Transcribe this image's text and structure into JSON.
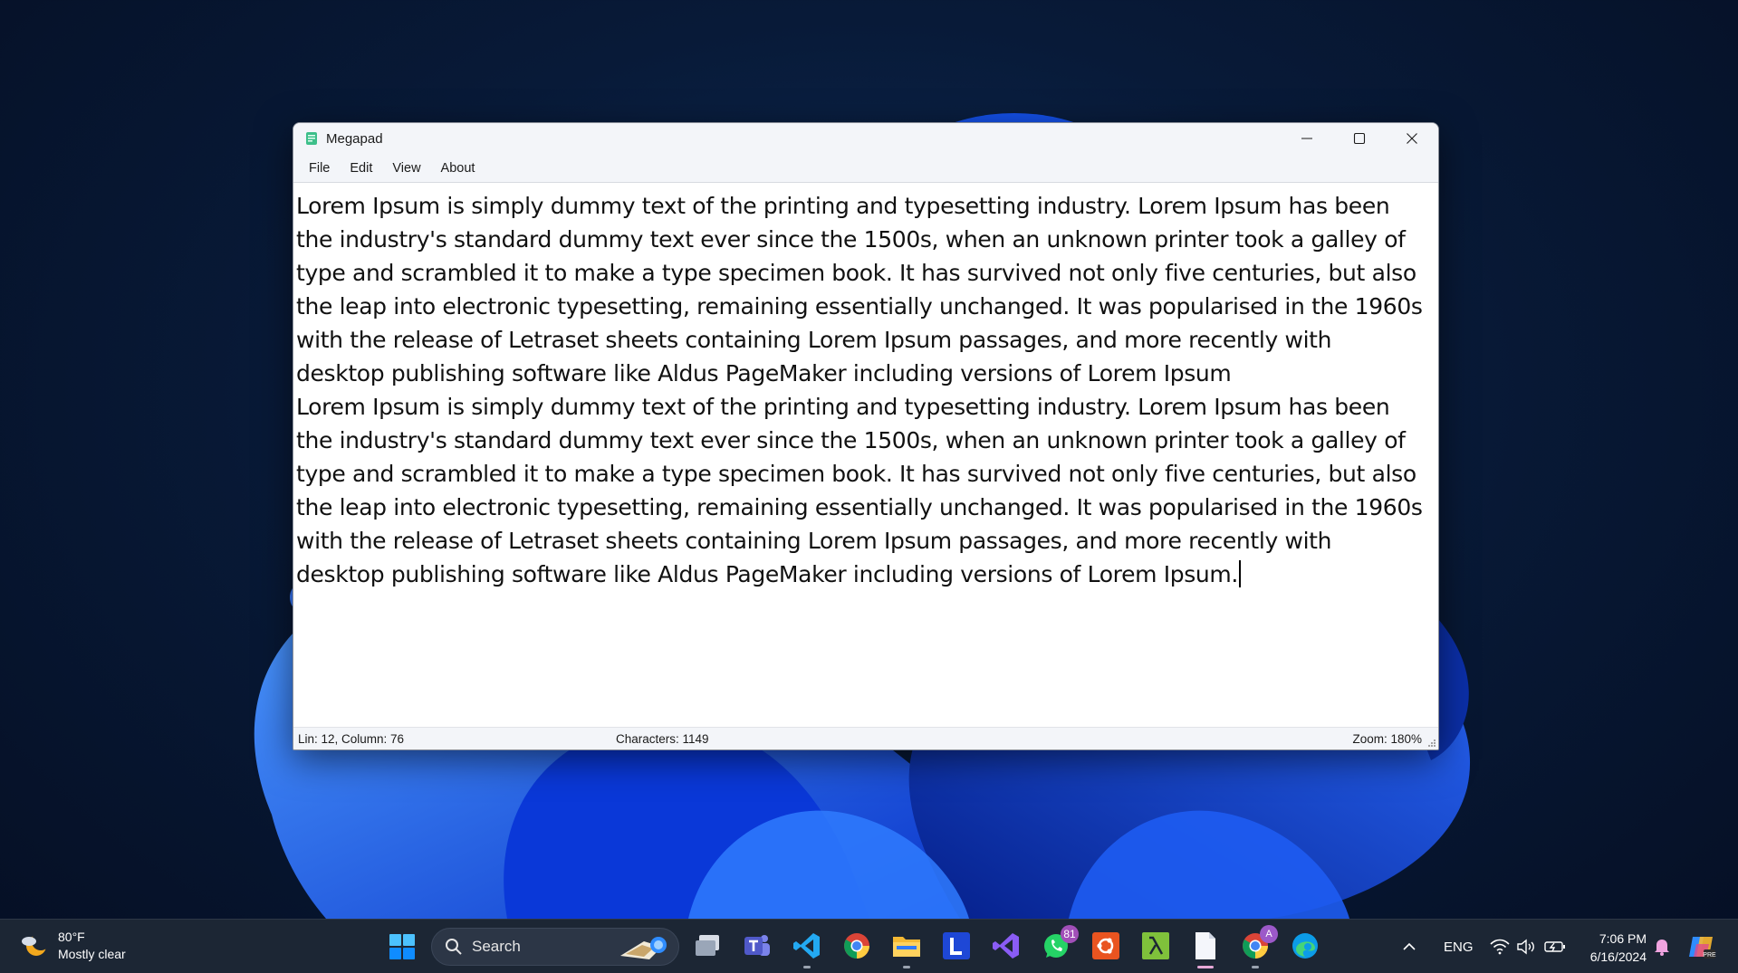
{
  "window": {
    "title": "Megapad",
    "menu": [
      "File",
      "Edit",
      "View",
      "About"
    ]
  },
  "editor": {
    "paragraphs": [
      "Lorem Ipsum is simply dummy text of the printing and typesetting industry. Lorem Ipsum has been the industry's standard dummy text ever since the 1500s, when an unknown printer took a galley of type and scrambled it to make a type specimen book. It has survived not only five centuries, but also the leap into electronic typesetting, remaining essentially unchanged. It was popularised in the 1960s with the release of Letraset sheets containing Lorem Ipsum passages, and more recently with desktop publishing software like Aldus PageMaker including versions of Lorem Ipsum",
      "Lorem Ipsum is simply dummy text of the printing and typesetting industry. Lorem Ipsum has been the industry's standard dummy text ever since the 1500s, when an unknown printer took a galley of type and scrambled it to make a type specimen book. It has survived not only five centuries, but also the leap into electronic typesetting, remaining essentially unchanged. It was popularised in the 1960s with the release of Letraset sheets containing Lorem Ipsum passages, and more recently with desktop publishing software like Aldus PageMaker including versions of Lorem Ipsum."
    ]
  },
  "status": {
    "position": "Lin: 12, Column: 76",
    "characters": "Characters: 1149",
    "zoom": "Zoom: 180%"
  },
  "taskbar": {
    "weather_temp": "80°F",
    "weather_desc": "Mostly clear",
    "search_label": "Search",
    "whatsapp_badge": "81",
    "chrome_profile_badge": "A",
    "language": "ENG",
    "time": "7:06 PM",
    "date": "6/16/2024",
    "apps": [
      "task-view",
      "teams",
      "vscode",
      "chrome",
      "file-explorer",
      "l-app",
      "visual-studio",
      "whatsapp",
      "ubuntu",
      "lambda-app",
      "megapad",
      "chrome-profile",
      "edge"
    ]
  },
  "colors": {
    "accent": "#0a5cff",
    "taskbar": "#1c2634",
    "window_chrome": "#f3f5f9"
  }
}
